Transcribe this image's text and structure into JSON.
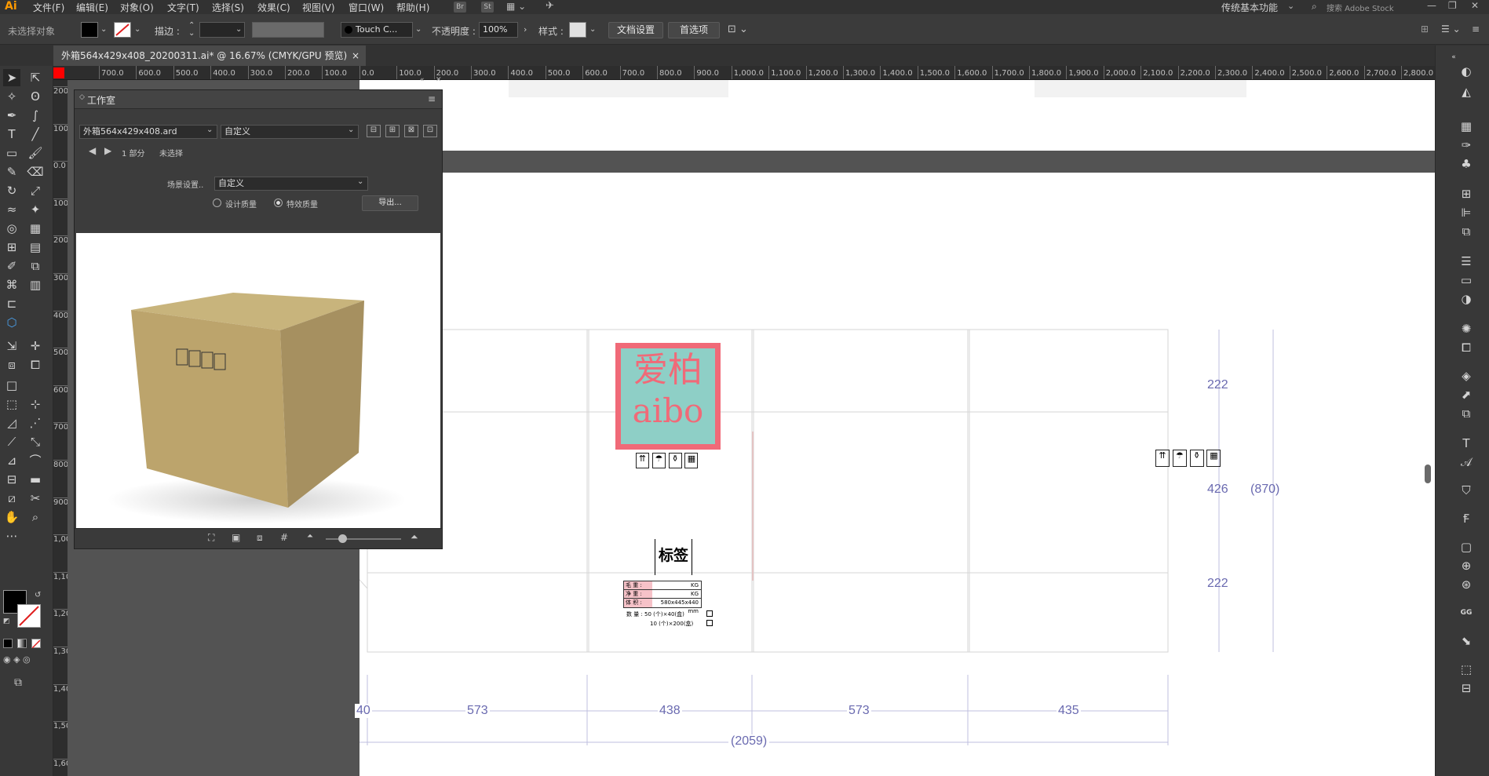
{
  "app": {
    "logo": "Ai"
  },
  "menu": [
    {
      "label": "文件(F)"
    },
    {
      "label": "编辑(E)"
    },
    {
      "label": "对象(O)"
    },
    {
      "label": "文字(T)"
    },
    {
      "label": "选择(S)"
    },
    {
      "label": "效果(C)"
    },
    {
      "label": "视图(V)"
    },
    {
      "label": "窗口(W)"
    },
    {
      "label": "帮助(H)"
    }
  ],
  "menubar_right": {
    "workspace": "传统基本功能",
    "search_placeholder": "搜索 Adobe Stock",
    "st_badge": "St",
    "br_badge": "Br"
  },
  "control": {
    "no_selection": "未选择对象",
    "stroke_label": "描边 :",
    "brush_name": "Touch C...",
    "opacity_label": "不透明度 :",
    "opacity_value": "100%",
    "style_label": "样式 :",
    "doc_settings": "文档设置",
    "preferences": "首选项"
  },
  "document_tab": {
    "title": "外箱564x429x408_20200311.ai* @ 16.67% (CMYK/GPU 预览)",
    "close": "×"
  },
  "ruler_h": [
    "700.0",
    "600.0",
    "500.0",
    "400.0",
    "300.0",
    "200.0",
    "100.0",
    "0.0",
    "100.0",
    "200.0",
    "300.0",
    "400.0",
    "500.0",
    "600.0",
    "700.0",
    "800.0",
    "900.0",
    "1,000.0",
    "1,100.0",
    "1,200.0",
    "1,300.0",
    "1,400.0",
    "1,500.0",
    "1,600.0",
    "1,700.0",
    "1,800.0",
    "1,900.0",
    "2,000.0",
    "2,100.0",
    "2,200.0",
    "2,300.0",
    "2,400.0",
    "2,500.0",
    "2,600.0",
    "2,700.0",
    "2,800.0"
  ],
  "ruler_v": [
    "200.",
    "100.",
    "0.0",
    "100.",
    "200.",
    "300.",
    "400.",
    "500.",
    "600.",
    "700.",
    "800.",
    "900.",
    "1,00",
    "1,100.0",
    "1,200.0",
    "1,300.0",
    "1,400.0",
    "1,500.0",
    "1,600.0"
  ],
  "panel": {
    "title": "工作室",
    "file_select": "外箱564x429x408.ard",
    "view_select": "自定义",
    "part_label": "1 部分",
    "unselected": "未选择",
    "scene_label": "场景设置..",
    "scene_select": "自定义",
    "radio_design": "设计质量",
    "radio_effect": "特效质量",
    "export_button": "导出..."
  },
  "dieline": {
    "logo_cn": "爱柏",
    "logo_en": "aibo",
    "label_title": "标签",
    "table_rows": [
      {
        "name": "毛 重 :",
        "unit": "KG"
      },
      {
        "name": "净 重 :",
        "unit": "KG"
      },
      {
        "name": "体 积 :",
        "unit": "580x445x440   mm"
      }
    ],
    "qty_label": "数 量 :",
    "qty_row1": "50 (个)×40(盒)",
    "qty_row2": "10 (个)×200(盒)",
    "dims_right": [
      "222",
      "426",
      "222"
    ],
    "dim_total_right": "(870)",
    "dims_bottom": [
      "40",
      "573",
      "438",
      "573",
      "435"
    ],
    "dim_total_bottom": "(2059)"
  }
}
